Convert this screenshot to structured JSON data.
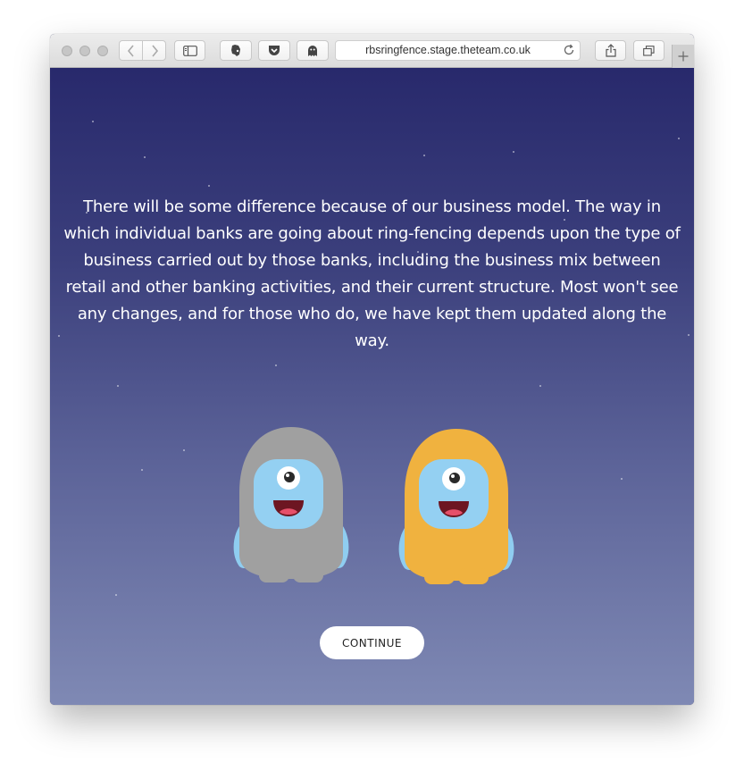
{
  "browser": {
    "url": "rbsringfence.stage.theteam.co.uk"
  },
  "page": {
    "message": "There will be some difference because of our business model. The way in which individual banks are going about ring-fencing depends upon the type of business carried out by those banks, including the business mix between retail and other banking activities, and their current structure. Most won't see any changes, and for those who do, we have kept them updated along the way.",
    "continue_label": "CONTINUE"
  },
  "colors": {
    "background_top": "#28296c",
    "background_bottom": "#7f89b4",
    "monster_grey": "#a0a0a0",
    "monster_orange": "#f0b23f",
    "monster_face": "#94d0f2"
  },
  "icons": [
    "back-icon",
    "forward-icon",
    "sidebar-icon",
    "evernote-icon",
    "pocket-icon",
    "ghostery-icon",
    "reload-icon",
    "share-icon",
    "tabs-icon",
    "new-tab-icon"
  ]
}
